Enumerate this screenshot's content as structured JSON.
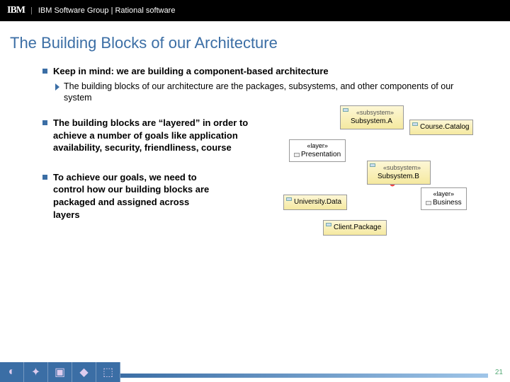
{
  "header": {
    "brand": "IBM",
    "group": "IBM Software Group | Rational software"
  },
  "title": "The Building Blocks of our Architecture",
  "bullets": {
    "b1": "Keep in mind: we are building a component-based architecture",
    "b1a": "The building blocks of our architecture are the packages, subsystems, and other components of our system",
    "b2": "The building blocks are “layered” in order to achieve a number of goals like application availability, security, friendliness, course",
    "b3": "To achieve our goals, we need to control how our building blocks are packaged and assigned across layers"
  },
  "dia": {
    "stSub": "«subsystem»",
    "stLay": "«layer»",
    "subA": "Subsystem.A",
    "subB": "Subsystem.B",
    "cat": "Course.Catalog",
    "pres": "Presentation",
    "biz": "Business",
    "uni": "University.Data",
    "cli": "Client.Package",
    "q": "?"
  },
  "page": "21"
}
